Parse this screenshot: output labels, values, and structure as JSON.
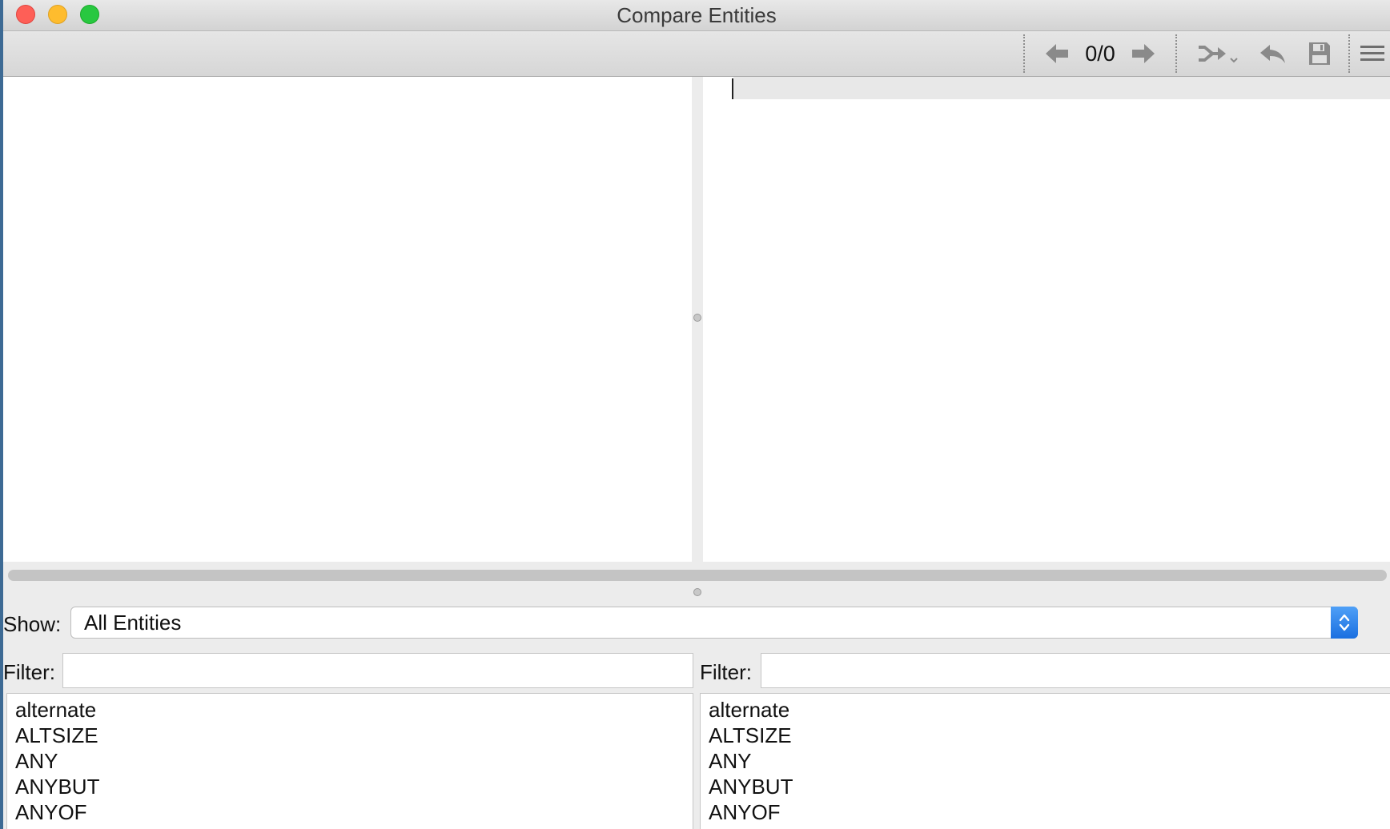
{
  "window": {
    "title": "Compare Entities"
  },
  "toolbar": {
    "counter": "0/0",
    "icons": [
      "arrow-left-icon",
      "arrow-right-icon",
      "merge-icon",
      "undo-icon",
      "save-icon",
      "menu-icon"
    ]
  },
  "filters": {
    "show_label": "Show:",
    "show_value": "All Entities",
    "left_label": "Filter:",
    "left_value": "",
    "right_label": "Filter:",
    "right_value": ""
  },
  "lists": {
    "left": [
      "alternate",
      "ALTSIZE",
      "ANY",
      "ANYBUT",
      "ANYOF"
    ],
    "right": [
      "alternate",
      "ALTSIZE",
      "ANY",
      "ANYBUT",
      "ANYOF"
    ]
  },
  "colors": {
    "close": "#fe5f57",
    "minimize": "#febc2e",
    "zoom": "#28c840",
    "accent": "#1a6fe0",
    "icon": "#8a8a8a"
  }
}
